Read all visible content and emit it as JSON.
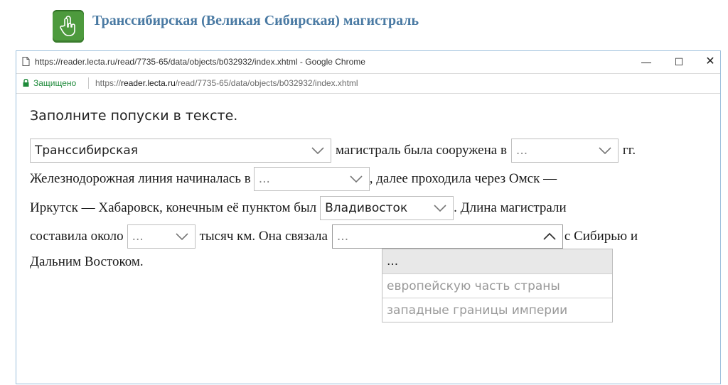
{
  "header": {
    "title": "Транссибирская (Великая Сибирская) магистраль"
  },
  "window": {
    "title": "https://reader.lecta.ru/read/7735-65/data/objects/b032932/index.xhtml - Google Chrome",
    "minimize": "—",
    "maximize": "☐",
    "close": "✕"
  },
  "address": {
    "secure_label": "Защищено",
    "url_prefix": "https://",
    "url_host": "reader.lecta.ru",
    "url_path": "/read/7735-65/data/objects/b032932/index.xhtml"
  },
  "exercise": {
    "instruction": "Заполните попуски в тексте.",
    "t1": "магистраль была сооружена в",
    "t2": "гг.",
    "t3": "Железнодорожная линия начиналась в",
    "t4": ", далее проходила через Омск —",
    "t5": "Иркутск — Хабаровск, конечным её пунктом был",
    "t6": ". Длина магистрали",
    "t7": "составила около",
    "t8": "тысяч км. Она связала",
    "t9": "с Сибирью и",
    "t10": "Дальним Востоком.",
    "dd1": "Транссибирская",
    "dd2": "...",
    "dd3": "...",
    "dd4": "Владивосток",
    "dd5": "...",
    "dd6": "...",
    "dd6_options": [
      "...",
      "европейскую часть страны",
      "западные границы империи"
    ]
  }
}
